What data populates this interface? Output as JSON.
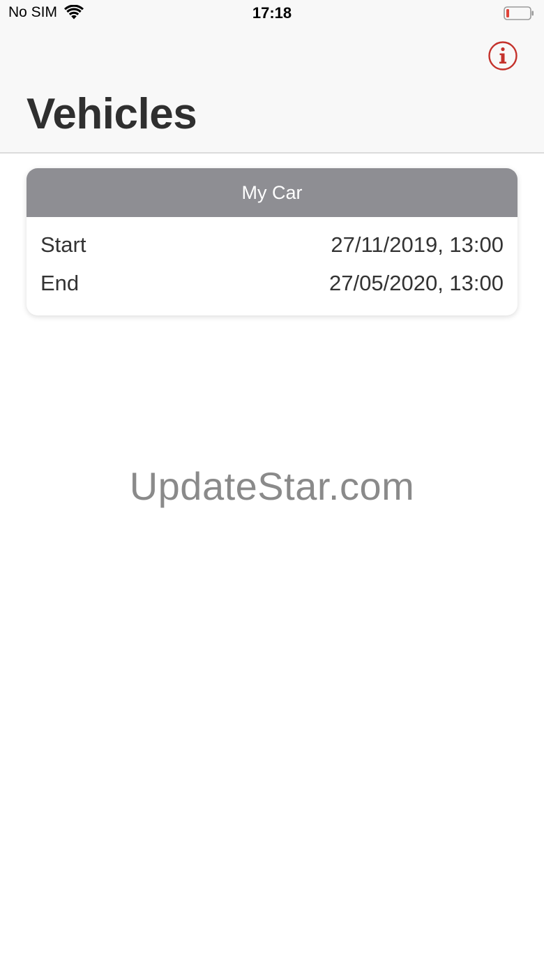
{
  "status_bar": {
    "carrier": "No SIM",
    "time": "17:18",
    "battery_color": "#e0443a"
  },
  "nav": {
    "title": "Vehicles",
    "info_icon": "info-icon",
    "accent_color": "#c4312b"
  },
  "vehicles": [
    {
      "name": "My Car",
      "start_label": "Start",
      "start_value": "27/11/2019, 13:00",
      "end_label": "End",
      "end_value": "27/05/2020, 13:00"
    }
  ],
  "watermark": "UpdateStar.com"
}
